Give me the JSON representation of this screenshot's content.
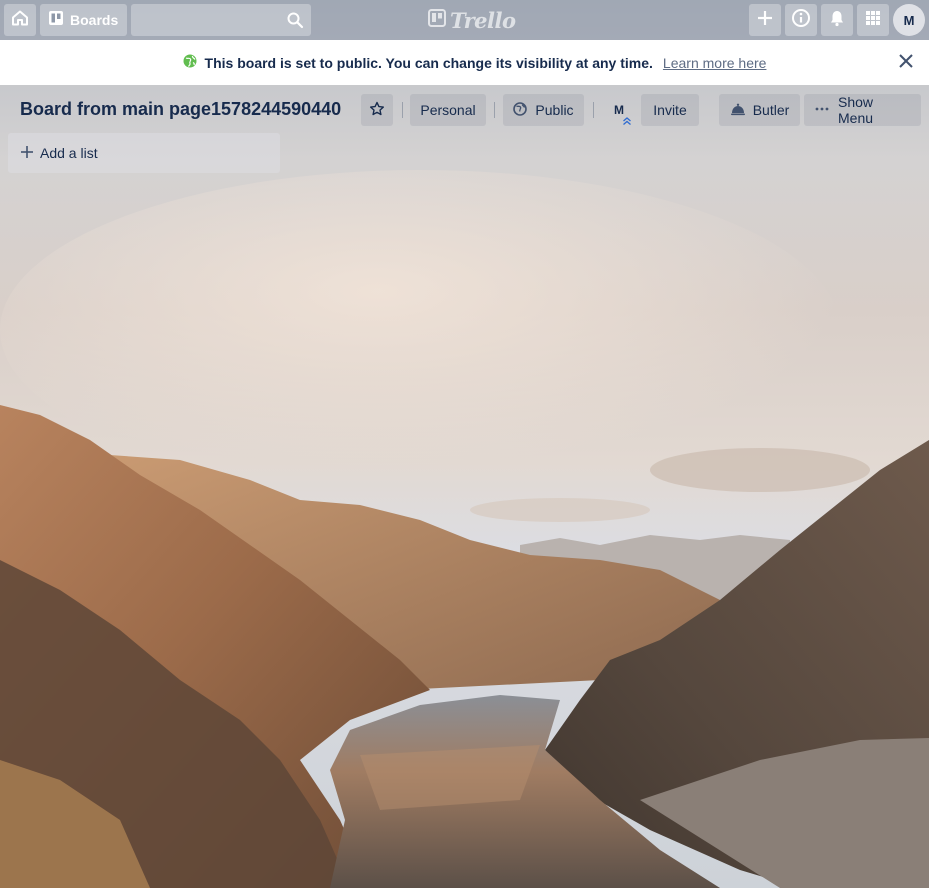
{
  "topbar": {
    "boards_label": "Boards",
    "search_placeholder": "",
    "logo_text": "Trello",
    "avatar_initial": "M"
  },
  "banner": {
    "message": "This board is set to public. You can change its visibility at any time.",
    "link_text": "Learn more here"
  },
  "board": {
    "title": "Board from main page1578244590440",
    "team_label": "Personal",
    "visibility_label": "Public",
    "member_initial": "M",
    "invite_label": "Invite",
    "butler_label": "Butler",
    "menu_label": "Show Menu"
  },
  "lists": {
    "add_list_label": "Add a list"
  },
  "colors": {
    "banner_globe": "#61bd4f",
    "text": "#172b4d",
    "link": "#5e6c84"
  }
}
